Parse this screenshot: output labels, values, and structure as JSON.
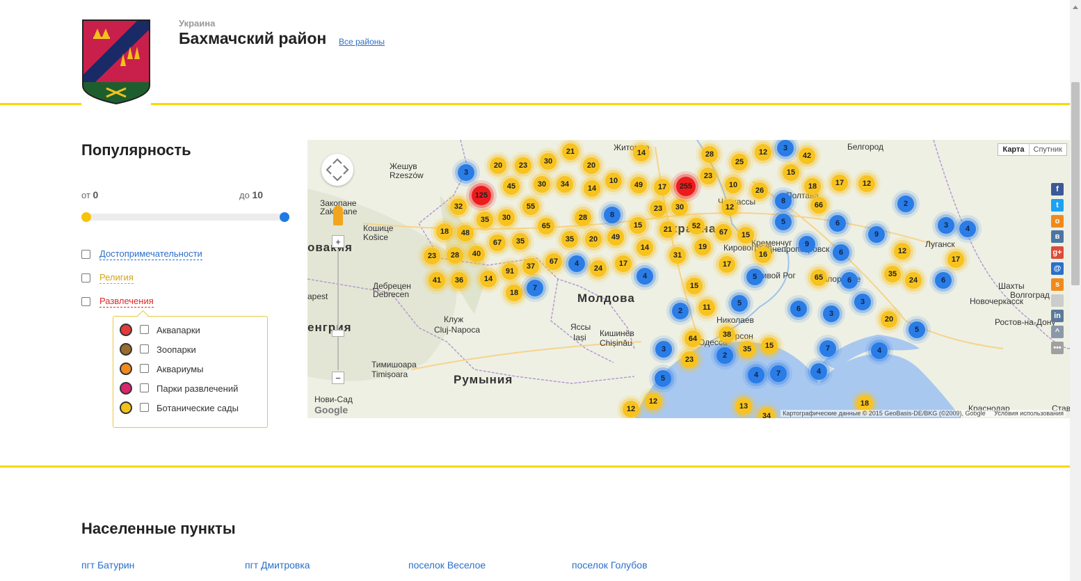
{
  "header": {
    "country": "Украина",
    "region_title": "Бахмачский район",
    "all_regions_link": "Все районы",
    "crest_colors": {
      "field": "#c8204b",
      "stripe": "#1a2a66",
      "base": "#1e5e2e",
      "ornament": "#f3c21a"
    }
  },
  "filter": {
    "title": "Популярность",
    "from_label": "от",
    "from_value": "0",
    "to_label": "до",
    "to_value": "10",
    "categories": [
      {
        "label": "Достопримечательности",
        "color": "#2a6fc9",
        "checked": false
      },
      {
        "label": "Религия",
        "color": "#d4a21a",
        "checked": false
      },
      {
        "label": "Развлечения",
        "color": "#e32626",
        "checked": false
      }
    ],
    "submenu": [
      {
        "label": "Аквапарки",
        "icon": "aquapark-icon",
        "color": "#e23b3b"
      },
      {
        "label": "Зоопарки",
        "icon": "zoo-icon",
        "color": "#9a6a2f"
      },
      {
        "label": "Аквариумы",
        "icon": "aquarium-icon",
        "color": "#f08a1c"
      },
      {
        "label": "Парки развлечений",
        "icon": "amusement-park-icon",
        "color": "#d7266e"
      },
      {
        "label": "Ботанические сады",
        "icon": "botanical-garden-icon",
        "color": "#f3c21a"
      }
    ]
  },
  "map": {
    "map_type": {
      "map": "Карта",
      "satellite": "Спутник"
    },
    "attribution": "Картографические данные © 2015 GeoBasis-DE/BKG (©2009), Google",
    "terms": "Условия использования",
    "logo": "Google",
    "zoom_in": "+",
    "zoom_out": "−",
    "places": [
      "Белгород",
      "Жешув",
      "Rzeszów",
      "Житомир",
      "Полтава",
      "Кошице",
      "Košice",
      "Украина",
      "Кировоград",
      "Днепропетровск",
      "Луганск",
      "Кременчуг",
      "Черкассы",
      "Кривой Рог",
      "Запорожье",
      "Шахты",
      "Новочеркасск",
      "Волгоград",
      "Ростов-на-Дону",
      "Молдова",
      "Дебрецен",
      "Debrecen",
      "Клуж",
      "Cluj-Napoca",
      "Яссы",
      "Iași",
      "Кишинёв",
      "Chișinău",
      "Николаев",
      "Херсон",
      "Одесса",
      "Тимишоара",
      "Timișoara",
      "Румыния",
      "Нови-Сад",
      "Краснодар",
      "Ставрополь",
      "Закопане",
      "Zakopane",
      "овакия",
      "енгрия",
      "apest"
    ],
    "clusters": {
      "yellow": [
        "21",
        "20",
        "23",
        "30",
        "20",
        "14",
        "28",
        "25",
        "12",
        "42",
        "15",
        "45",
        "30",
        "34",
        "14",
        "10",
        "49",
        "17",
        "23",
        "10",
        "26",
        "18",
        "17",
        "12",
        "32",
        "35",
        "30",
        "55",
        "28",
        "23",
        "30",
        "12",
        "66",
        "18",
        "48",
        "67",
        "35",
        "65",
        "35",
        "20",
        "49",
        "15",
        "21",
        "52",
        "67",
        "15",
        "23",
        "28",
        "40",
        "67",
        "14",
        "31",
        "19",
        "17",
        "16",
        "41",
        "36",
        "14",
        "91",
        "37",
        "24",
        "17",
        "65",
        "35",
        "24",
        "18",
        "15",
        "11",
        "12",
        "17",
        "20",
        "38",
        "64",
        "35",
        "15",
        "23",
        "12",
        "12",
        "13",
        "34",
        "18"
      ],
      "blue": [
        "3",
        "3",
        "8",
        "8",
        "5",
        "6",
        "2",
        "3",
        "4",
        "9",
        "9",
        "6",
        "5",
        "4",
        "7",
        "4",
        "6",
        "3",
        "3",
        "2",
        "5",
        "6",
        "5",
        "3",
        "2",
        "5",
        "7",
        "4",
        "4",
        "7",
        "4",
        "6"
      ],
      "red": [
        "125",
        "255"
      ]
    }
  },
  "share": [
    {
      "icon": "facebook-icon",
      "glyph": "f",
      "color": "#3b5998"
    },
    {
      "icon": "twitter-icon",
      "glyph": "t",
      "color": "#1da1f2"
    },
    {
      "icon": "odnoklassniki-icon",
      "glyph": "о",
      "color": "#f08a1c"
    },
    {
      "icon": "vk-icon",
      "glyph": "в",
      "color": "#4c75a3"
    },
    {
      "icon": "google-plus-icon",
      "glyph": "g+",
      "color": "#dd4b39"
    },
    {
      "icon": "mail-icon",
      "glyph": "@",
      "color": "#2a6fc9"
    },
    {
      "icon": "surfingbird-icon",
      "glyph": "s",
      "color": "#f08a1c"
    },
    {
      "icon": "blogger-icon",
      "glyph": "",
      "color": "#cccccc"
    },
    {
      "icon": "linkedin-icon",
      "glyph": "in",
      "color": "#5b7a99"
    },
    {
      "icon": "livejournal-icon",
      "glyph": "^",
      "color": "#8a98a8"
    },
    {
      "icon": "more-icon",
      "glyph": "•••",
      "color": "#a0a0a0"
    }
  ],
  "settlements": {
    "title": "Населенные пункты",
    "items": [
      "пгт Батурин",
      "пгт Дмитровка",
      "поселок Веселое",
      "поселок Голубов"
    ]
  }
}
